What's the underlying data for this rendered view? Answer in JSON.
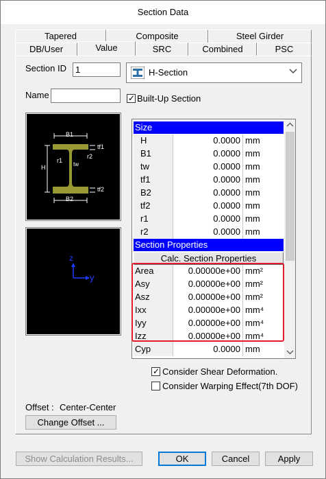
{
  "window": {
    "title": "Section Data"
  },
  "tabs_back": [
    "Tapered",
    "Composite",
    "Steel Girder"
  ],
  "tabs_front": [
    "DB/User",
    "Value",
    "SRC",
    "Combined",
    "PSC"
  ],
  "active_tab": "Value",
  "form": {
    "section_id_label": "Section ID",
    "section_id_value": "1",
    "name_label": "Name",
    "name_value": "",
    "section_type": "H-Section",
    "built_up_label": "Built-Up Section",
    "built_up_checked": true
  },
  "shape_labels": {
    "B1": "B1",
    "B2": "B2",
    "H": "H",
    "tw": "tw",
    "tf1": "tf1",
    "tf2": "tf2",
    "r1": "r1",
    "r2": "r2"
  },
  "axis_labels": {
    "z": "z",
    "y": "y"
  },
  "table": {
    "size_header": "Size",
    "size_rows": [
      {
        "name": "H",
        "value": "0.0000",
        "unit": "mm"
      },
      {
        "name": "B1",
        "value": "0.0000",
        "unit": "mm"
      },
      {
        "name": "tw",
        "value": "0.0000",
        "unit": "mm"
      },
      {
        "name": "tf1",
        "value": "0.0000",
        "unit": "mm"
      },
      {
        "name": "B2",
        "value": "0.0000",
        "unit": "mm"
      },
      {
        "name": "tf2",
        "value": "0.0000",
        "unit": "mm"
      },
      {
        "name": "r1",
        "value": "0.0000",
        "unit": "mm"
      },
      {
        "name": "r2",
        "value": "0.0000",
        "unit": "mm"
      }
    ],
    "props_header": "Section Properties",
    "calc_button": "Calc. Section Properties",
    "prop_rows": [
      {
        "name": "Area",
        "value": "0.00000e+00",
        "unit": "mm²"
      },
      {
        "name": "Asy",
        "value": "0.00000e+00",
        "unit": "mm²"
      },
      {
        "name": "Asz",
        "value": "0.00000e+00",
        "unit": "mm²"
      },
      {
        "name": "Ixx",
        "value": "0.00000e+00",
        "unit": "mm⁴"
      },
      {
        "name": "Iyy",
        "value": "0.00000e+00",
        "unit": "mm⁴"
      },
      {
        "name": "Izz",
        "value": "0.00000e+00",
        "unit": "mm⁴"
      },
      {
        "name": "Cyp",
        "value": "0.0000",
        "unit": "mm"
      }
    ]
  },
  "options": {
    "shear_label": "Consider Shear Deformation.",
    "shear_checked": true,
    "warping_label": "Consider Warping Effect(7th DOF)",
    "warping_checked": false
  },
  "offset": {
    "label": "Offset :",
    "value": "Center-Center",
    "change_button": "Change Offset ..."
  },
  "buttons": {
    "show_calc": "Show Calculation Results...",
    "ok": "OK",
    "cancel": "Cancel",
    "apply": "Apply"
  },
  "colors": {
    "table_header": "#0000ff",
    "highlight_box": "#e21b2c",
    "shape_fill": "#999933",
    "accent": "#0078d7"
  },
  "icons": {
    "section_type": "h-section-icon",
    "dropdown": "chevron-down-icon"
  }
}
